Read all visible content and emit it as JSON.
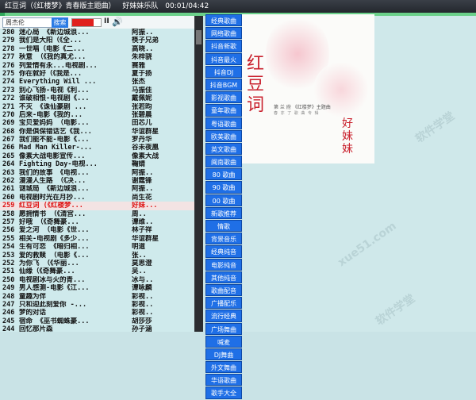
{
  "window": {
    "song_title": "红豆词（《红楼梦》青春版主题曲）",
    "artist": "好妹妹乐队",
    "time": "00:01/04:42"
  },
  "player": {
    "search_value": "周杰伦",
    "search_button": "搜索",
    "progress": 0.01,
    "volume": 0.75,
    "pause_icon": "II",
    "speaker_icon": "🔊"
  },
  "playlist": [
    {
      "num": "280",
      "title": "迷心局 《新边城浪...",
      "artist": "阿振.."
    },
    {
      "num": "279",
      "title": "我们是大阳（《全...",
      "artist": "筷子兄弟"
    },
    {
      "num": "278",
      "title": "一世唱（电影《二...",
      "artist": "高晓.."
    },
    {
      "num": "277",
      "title": "秋意 （《我的真尤...",
      "artist": "朱梓骁"
    },
    {
      "num": "276",
      "title": "列爱情有永...电视剧...",
      "artist": "赛雅"
    },
    {
      "num": "275",
      "title": "你在就好（《我是...",
      "artist": "夏于扬"
    },
    {
      "num": "274",
      "title": "Everything Will ...",
      "artist": "张杰"
    },
    {
      "num": "273",
      "title": "别心飞扬-电视《利...",
      "artist": "马振佳"
    },
    {
      "num": "272",
      "title": "谁破相恨-电视剧《...",
      "artist": "戴佩妮"
    },
    {
      "num": "271",
      "title": "不灭 《诛仙豪剧 ...",
      "artist": "张若昀"
    },
    {
      "num": "270",
      "title": "后来-电影《我的...",
      "artist": "张碧晨"
    },
    {
      "num": "269",
      "title": "宝贝爱妈妈 （电影...",
      "artist": "田芯儿"
    },
    {
      "num": "268",
      "title": "你是俱保错话艺《我...",
      "artist": "华谊群星"
    },
    {
      "num": "267",
      "title": "我们能不能-电影《...",
      "artist": "罗丹华"
    },
    {
      "num": "266",
      "title": "Mad Man Killer-...",
      "artist": "谷未夜凰"
    },
    {
      "num": "265",
      "title": "像素大战电影宣传...",
      "artist": "像素大战"
    },
    {
      "num": "264",
      "title": "Fighting Day-电视...",
      "artist": "鞠婧"
    },
    {
      "num": "263",
      "title": "我们的故事 《电视...",
      "artist": "阿振.."
    },
    {
      "num": "262",
      "title": "漫漫人生路 （《决...",
      "artist": "谢霆锋"
    },
    {
      "num": "261",
      "title": "谜城局 《新边城浪...",
      "artist": "阿振.."
    },
    {
      "num": "260",
      "title": "电视剧时光在月抄...",
      "artist": "尚生花"
    },
    {
      "num": "259",
      "title": "红豆词 (《红楼梦...",
      "artist": "好妹..."
    },
    {
      "num": "258",
      "title": "愿拥情书 （《清宫...",
      "artist": "周.."
    },
    {
      "num": "257",
      "title": "好哦 （《奇舞豪...",
      "artist": "谭维.."
    },
    {
      "num": "256",
      "title": "爱之河 （电影《世...",
      "artist": "林子祥"
    },
    {
      "num": "255",
      "title": "相关-电视剧《多少...",
      "artist": "华谊群星"
    },
    {
      "num": "254",
      "title": "生有可恋 《暗归相...",
      "artist": "明道"
    },
    {
      "num": "253",
      "title": "爱的救赎 （电影《...",
      "artist": "张.."
    },
    {
      "num": "252",
      "title": "为你飞 （《华丽...",
      "artist": "莫思澄"
    },
    {
      "num": "251",
      "title": "仙缘（《奇舞豪...",
      "artist": "吴.."
    },
    {
      "num": "250",
      "title": "电视剧冰与火的青...",
      "artist": "冰与.."
    },
    {
      "num": "249",
      "title": "男人感测-电影《江...",
      "artist": "谭咏麟"
    },
    {
      "num": "248",
      "title": "童趣为伴",
      "artist": "彩视.."
    },
    {
      "num": "247",
      "title": "只和迎此刻爱你 -...",
      "artist": "彩视.."
    },
    {
      "num": "246",
      "title": "梦的对话",
      "artist": "彩视.."
    },
    {
      "num": "245",
      "title": "宿命 《巫书蜘蛛豪...",
      "artist": "胡莎莎"
    },
    {
      "num": "244",
      "title": "回忆那片森",
      "artist": "孙子涵"
    },
    {
      "num": "243",
      "title": "爱Two",
      "artist": "彩视.."
    },
    {
      "num": "242",
      "title": "幻影者",
      "artist": "彩视.."
    }
  ],
  "selected_index": 21,
  "categories": [
    "经典歌曲",
    "网络歌曲",
    "抖音新歌",
    "抖音最火",
    "抖音DJ",
    "抖音BGM",
    "影视歌曲",
    "童年歌曲",
    "粤语歌曲",
    "欧美歌曲",
    "英文歌曲",
    "闽南歌曲",
    "80 歌曲",
    "90 歌曲",
    "00 歌曲",
    "新歌推荐",
    "情歌",
    "背景音乐",
    "经典纯音",
    "电影纯音",
    "其他纯音",
    "歌曲配音",
    "广播配乐",
    "流行经典",
    "广场舞曲",
    "喊麦",
    "DJ舞曲",
    "外文舞曲",
    "华语歌曲",
    "歌手大全"
  ],
  "cover": {
    "title_big": "红豆词",
    "title_small": "好妹妹",
    "subtitle": "第 兰 府 《红楼梦》主题曲",
    "tagline": "春 亦 了 歌 曲 专 辑"
  },
  "watermark": [
    "xue51.com",
    "软件学堂"
  ]
}
